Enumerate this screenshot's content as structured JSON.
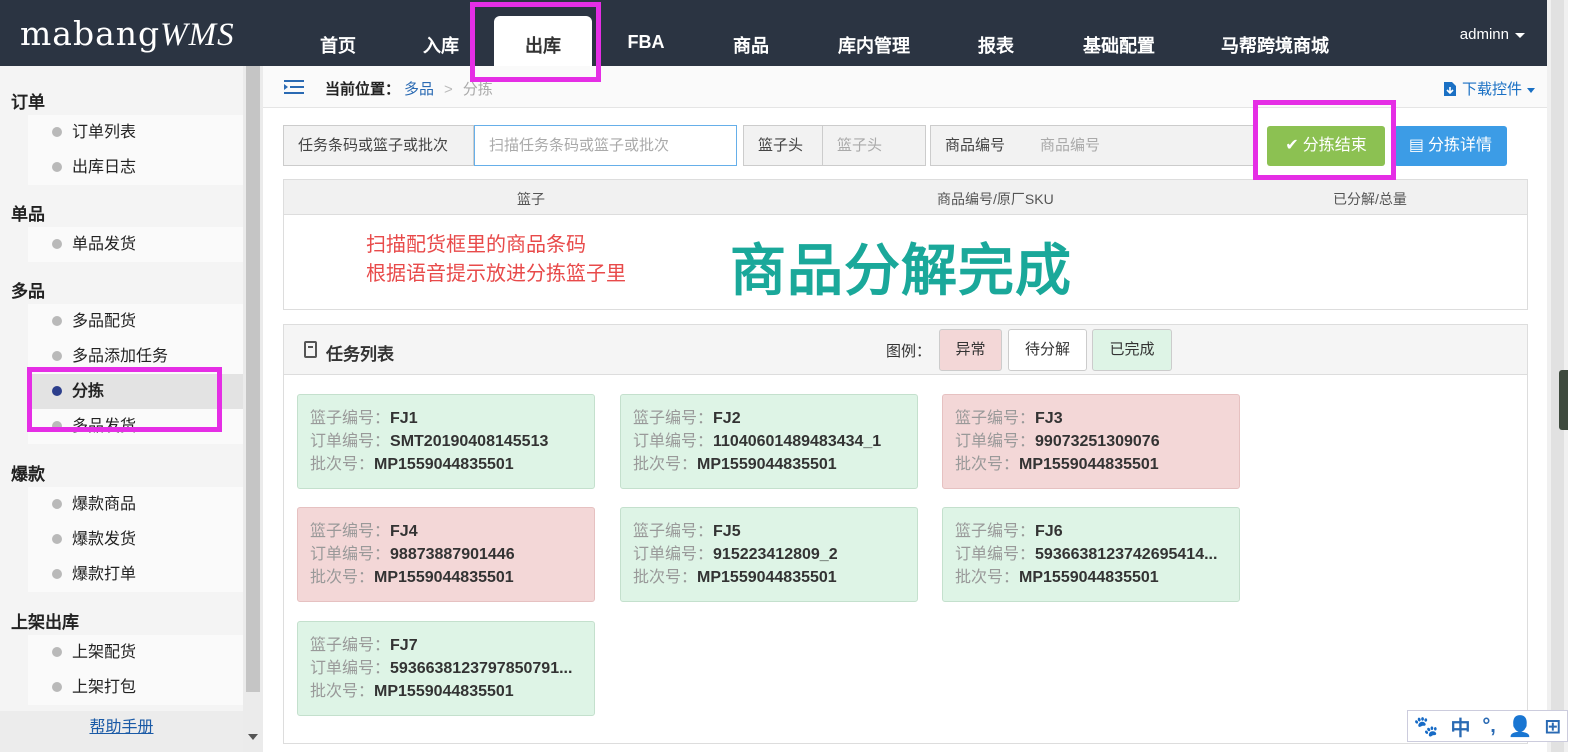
{
  "app": {
    "logo_main": "mabang",
    "logo_suffix": "WMS"
  },
  "nav": {
    "items": [
      "首页",
      "入库",
      "出库",
      "FBA",
      "商品",
      "库内管理",
      "报表",
      "基础配置",
      "马帮跨境商城"
    ],
    "active": "出库",
    "user": "adminn"
  },
  "sidebar": {
    "sections": [
      {
        "title": "订单",
        "items": [
          "订单列表",
          "出库日志"
        ]
      },
      {
        "title": "单品",
        "items": [
          "单品发货"
        ]
      },
      {
        "title": "多品",
        "items": [
          "多品配货",
          "多品添加任务",
          "分拣",
          "多品发货"
        ]
      },
      {
        "title": "爆款",
        "items": [
          "爆款商品",
          "爆款发货",
          "爆款打单"
        ]
      },
      {
        "title": "上架出库",
        "items": [
          "上架配货",
          "上架打包"
        ]
      }
    ],
    "active_item": "分拣",
    "help": "帮助手册"
  },
  "breadcrumb": {
    "label": "当前位置：",
    "level1": "多品",
    "sep": ">",
    "level2": "分拣"
  },
  "download": "下载控件",
  "filters": {
    "task_label": "任务条码或篮子或批次",
    "task_placeholder": "扫描任务条码或篮子或批次",
    "basket_label": "篮子头",
    "basket_placeholder": "篮子头",
    "product_label": "商品编号",
    "product_placeholder": "商品编号",
    "finish_button": "分拣结束",
    "detail_button": "分拣详情"
  },
  "basket_table": {
    "headers": [
      "篮子",
      "商品编号/原厂SKU",
      "已分解/总量"
    ],
    "hint_line1": "扫描配货框里的商品条码",
    "hint_line2": "根据语音提示放进分拣篮子里",
    "status": "商品分解完成"
  },
  "tasks": {
    "title": "任务列表",
    "legend_label": "图例：",
    "legend": [
      "异常",
      "待分解",
      "已完成"
    ],
    "field_labels": {
      "basket": "篮子编号：",
      "order": "订单编号：",
      "batch": "批次号："
    },
    "cards": [
      {
        "basket": "FJ1",
        "order": "SMT20190408145513",
        "batch": "MP1559044835501",
        "state": "ok"
      },
      {
        "basket": "FJ2",
        "order": "11040601489483434_1",
        "batch": "MP1559044835501",
        "state": "ok"
      },
      {
        "basket": "FJ3",
        "order": "99073251309076",
        "batch": "MP1559044835501",
        "state": "bad"
      },
      {
        "basket": "FJ4",
        "order": "98873887901446",
        "batch": "MP1559044835501",
        "state": "bad"
      },
      {
        "basket": "FJ5",
        "order": "915223412809_2",
        "batch": "MP1559044835501",
        "state": "ok"
      },
      {
        "basket": "FJ6",
        "order": "5936638123742695414...",
        "batch": "MP1559044835501",
        "state": "ok"
      },
      {
        "basket": "FJ7",
        "order": "5936638123797850791...",
        "batch": "MP1559044835501",
        "state": "ok"
      }
    ]
  },
  "ime": {
    "lang": "中",
    "punct": "°,"
  },
  "colors": {
    "topbar": "#2b3442",
    "highlight": "#e52ee5",
    "ok": "#def4e6",
    "bad": "#f3d7d7",
    "status": "#1aa89a",
    "hint": "#e84a4a"
  }
}
